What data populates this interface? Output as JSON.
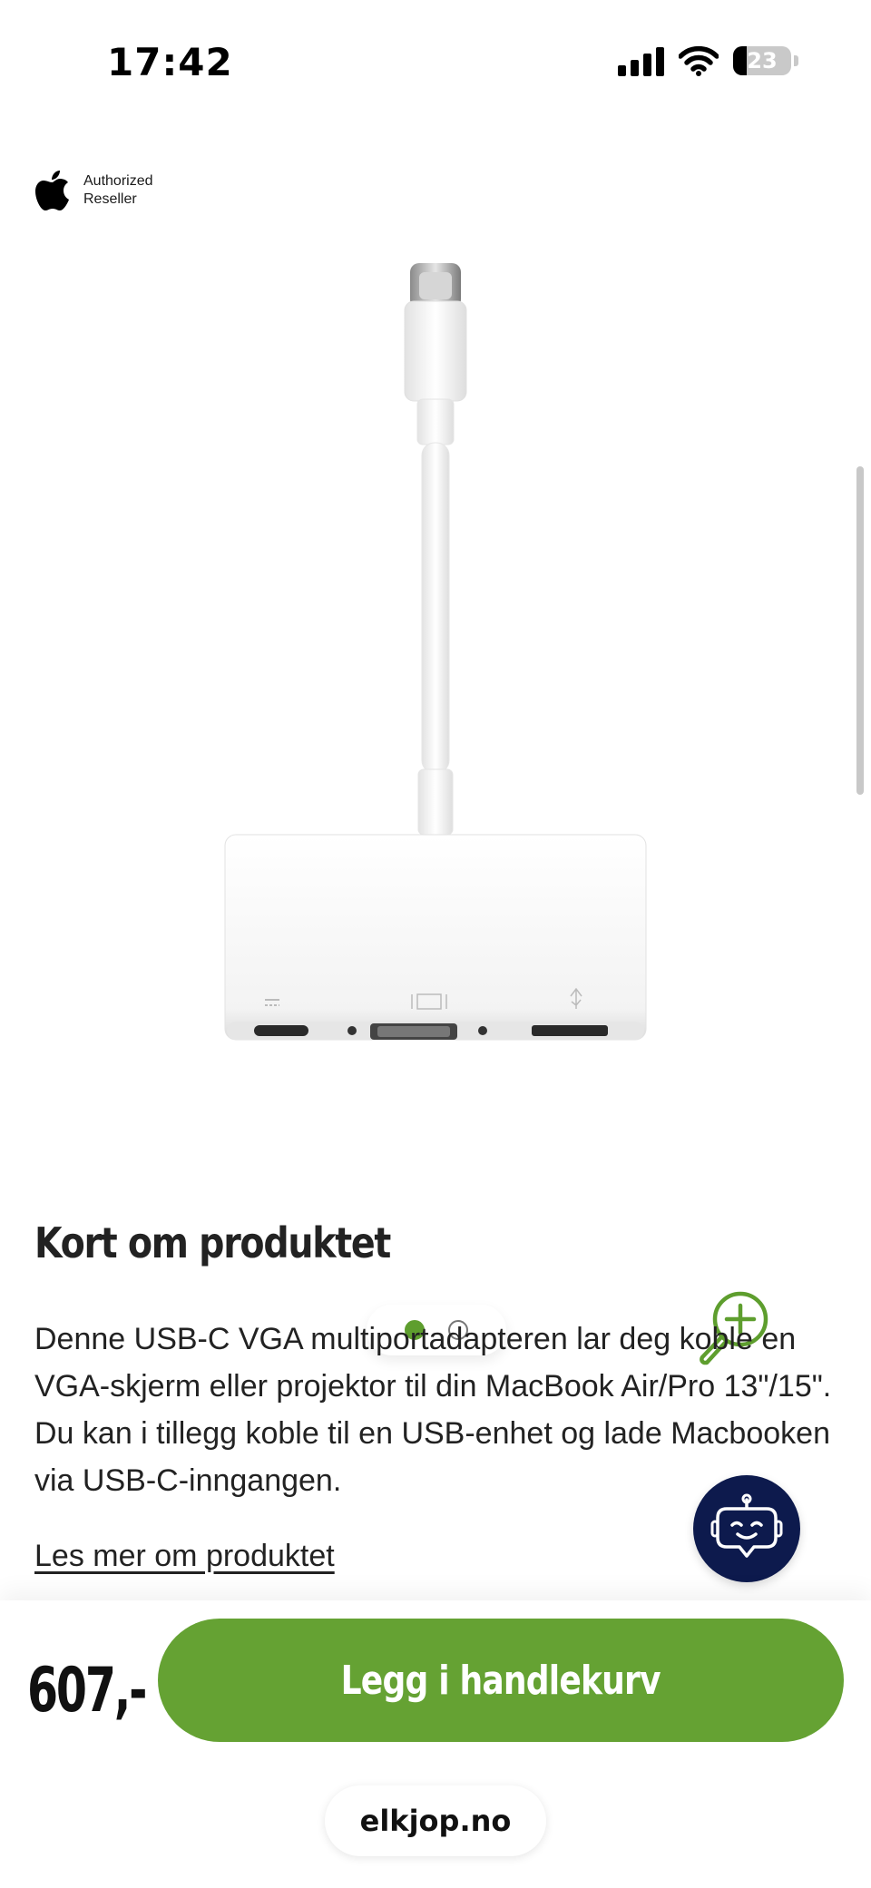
{
  "status_bar": {
    "time": "17:42",
    "battery_level": "23",
    "icons": [
      "signal-icon",
      "wifi-icon",
      "battery-icon"
    ]
  },
  "badge": {
    "line1": "Authorized",
    "line2": "Reseller",
    "icon": "apple-logo-icon"
  },
  "gallery": {
    "image_count": 2,
    "active_index": 0,
    "zoom_icon": "zoom-in-icon"
  },
  "summary": {
    "title": "Kort om produktet",
    "text": "Denne USB-C VGA multiportadapteren lar deg koble en VGA-skjerm eller projektor til din MacBook Air/Pro 13\"/15\". Du kan i tillegg koble til en USB-enhet og lade Macbooken via USB-C-inngangen.",
    "read_more": "Les mer om produktet"
  },
  "chat": {
    "icon": "chatbot-icon"
  },
  "purchase": {
    "price": "607,-",
    "add_to_cart": "Legg i handlekurv"
  },
  "browser": {
    "url": "elkjop.no"
  },
  "colors": {
    "brand_green": "#65a233",
    "chat_navy": "#0d1a4d"
  }
}
